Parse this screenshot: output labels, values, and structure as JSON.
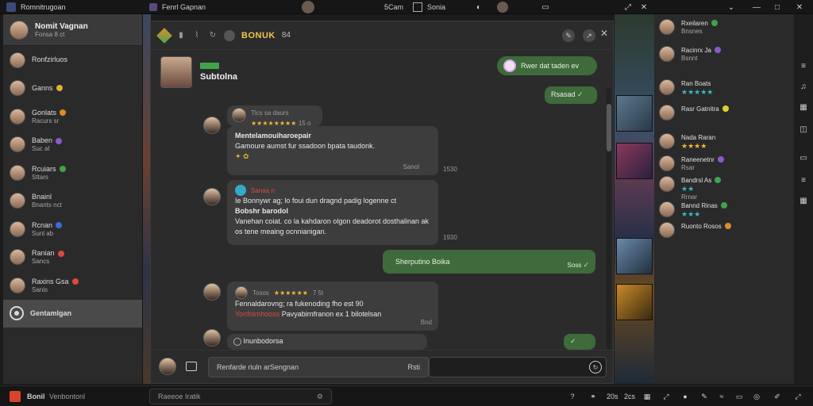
{
  "titlebar": {
    "app_title": "Romnitrugoan",
    "tab1": "Fenrl Gapnan",
    "tab2_a": "5Cam",
    "tab2_b": "Sonia"
  },
  "sidebar": {
    "header": {
      "name": "Nomit Vagnan",
      "sub": "Fonsa 8 ct"
    },
    "items": [
      {
        "label": "Ronfzirluos",
        "sub": "",
        "dot": ""
      },
      {
        "label": "Ganns",
        "sub": "",
        "dot": "#e0b030"
      },
      {
        "label": "Gonlats",
        "sub": "Racurs sr",
        "dot": "#e08a2a"
      },
      {
        "label": "Baben",
        "sub": "Suc al",
        "dot": "#8a5ac8"
      },
      {
        "label": "Rcuiars",
        "sub": "Sttars",
        "dot": "#3fa34a"
      },
      {
        "label": "Bnainl",
        "sub": "Bnants nct",
        "dot": ""
      },
      {
        "label": "Rcnan",
        "sub": "Sunl ab",
        "dot": "#3a6ad8"
      },
      {
        "label": "Ranian",
        "sub": "Sancs",
        "dot": "#d84a3a"
      },
      {
        "label": "Raxins Gsa",
        "sub": "Sanis",
        "dot": "#d84a3a"
      }
    ],
    "active_item": "Gentamlgan"
  },
  "chat": {
    "title": "BONUK",
    "count": "84",
    "contact_name": "Subtolna",
    "messages": [
      {
        "side": "out",
        "text": "Rwer dat taden ev"
      },
      {
        "side": "out",
        "text": "Rsasad"
      },
      {
        "side": "in",
        "meta": "Tlcs sa daurs",
        "stars": "★★★★★★★★",
        "meta2": "15 o",
        "title": "Mentelamouiharoepair",
        "body": "Gamoure aumst fur ssadoon bpata taudonk.",
        "time_a": "Sanol",
        "time_b": "1530"
      },
      {
        "side": "in",
        "meta": "Sanaa n",
        "meta_color": "#d84a3a",
        "body_top": "Ie  Bonnywr ag; lo foui dun dragnd padig logenne ct",
        "title": "Bobshr barodol",
        "body": "Vanehan coiat. co la kahdaron olgon deadorot dosthalinan ak os tene meaing ocnnianigan.",
        "time_a": "",
        "time_b": "1930"
      },
      {
        "side": "out",
        "text": "Sherputino Boika",
        "time": "Soss"
      },
      {
        "side": "in",
        "meta": "Tosos",
        "stars": "★★★★★★",
        "meta2": "7 5t",
        "body": "Fennaldarovng; ra fukenoding fho  est 90",
        "alert": "Yonfoimhooss",
        "body2": "Pavyabirnfranon ex 1 bilotelsan",
        "time_a": "Bnd"
      },
      {
        "side": "in",
        "text": "Inunbodorsa"
      }
    ],
    "input_placeholder": "Renfarde riuln arSengnan",
    "input_right": "Rsti"
  },
  "rpanel": {
    "items": [
      {
        "label": "Rxeilaren",
        "sub": "Bnsnes",
        "dot": "#3fa34a",
        "stars": ""
      },
      {
        "label": "Racinrx Ja",
        "sub": "Bsnnt",
        "dot": "#8a5ac8",
        "stars": ""
      },
      {
        "label": "Ran Boats",
        "sub": "",
        "dot": "",
        "stars": "★★★★★",
        "star_color": "teal"
      },
      {
        "label": "Rasr Gatnitra",
        "sub": "",
        "dot": "#e0d030",
        "stars": ""
      },
      {
        "label": "Nada Raran",
        "sub": "",
        "dot": "",
        "stars": "★★★★",
        "star_color": "gold"
      },
      {
        "label": "Raneenetnr",
        "sub": "Rsar",
        "dot": "#8a5ac8",
        "stars": ""
      },
      {
        "label": "Bandrsl As",
        "sub": "Rrnar",
        "dot": "#3fa34a",
        "stars": "★★",
        "star_color": "teal"
      },
      {
        "label": "Bannd Rinas",
        "sub": "",
        "dot": "#3fa34a",
        "stars": "★★★",
        "star_color": "teal"
      },
      {
        "label": "Ruonto Rosos",
        "sub": "",
        "dot": "#e08a2a",
        "stars": ""
      }
    ]
  },
  "bottombar": {
    "app": "Bonil",
    "status": "Venbontonl",
    "search_placeholder": "Raeeoe Iratik",
    "zoom_a": "20s",
    "zoom_b": "2cs"
  }
}
